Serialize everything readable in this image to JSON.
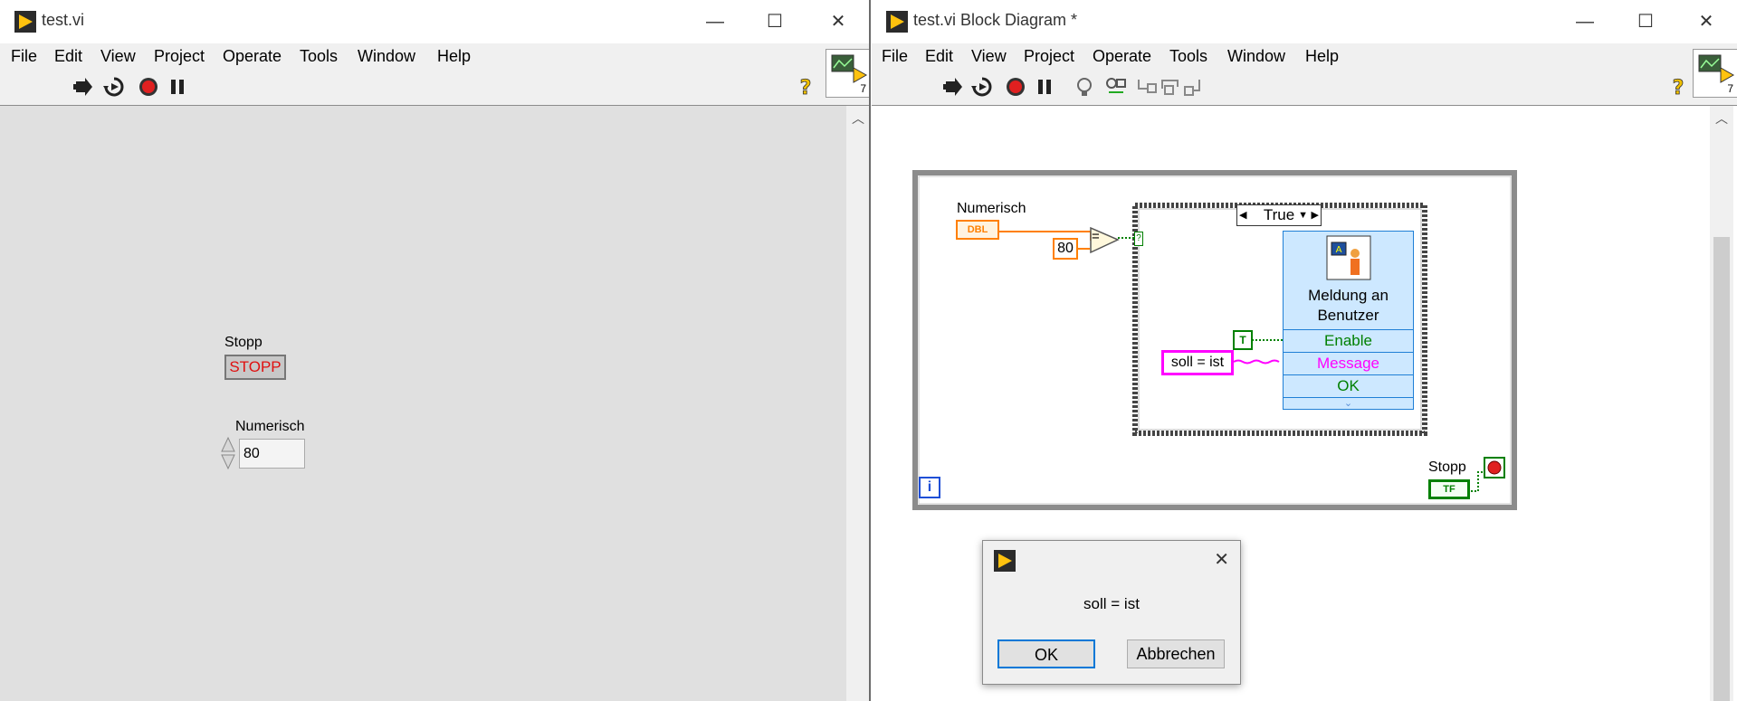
{
  "front_panel": {
    "title": "test.vi",
    "menu": [
      "File",
      "Edit",
      "View",
      "Project",
      "Operate",
      "Tools",
      "Window",
      "Help"
    ],
    "connector_number": "7",
    "controls": {
      "stop_label": "Stopp",
      "stop_button_text": "STOPP",
      "numeric_label": "Numerisch",
      "numeric_value": "80"
    }
  },
  "block_diagram": {
    "title": "test.vi Block Diagram *",
    "menu": [
      "File",
      "Edit",
      "View",
      "Project",
      "Operate",
      "Tools",
      "Window",
      "Help"
    ],
    "connector_number": "7",
    "numeric_label": "Numerisch",
    "numeric_type": "DBL",
    "constant_80": "80",
    "equal_symbol": "=",
    "case_selector": "True",
    "string_constant": "soll = ist",
    "bool_constant": "T",
    "message_node": {
      "title_line1": "Meldung an",
      "title_line2": "Benutzer",
      "terminals": [
        "Enable",
        "Message",
        "OK"
      ]
    },
    "stop_label": "Stopp",
    "stop_terminal_type": "TF",
    "iteration_label": "i"
  },
  "dialog": {
    "message": "soll = ist",
    "ok_label": "OK",
    "cancel_label": "Abbrechen"
  },
  "colors": {
    "labview_orange": "#ff8000",
    "string_pink": "#ff00ff",
    "boolean_green": "#008000",
    "node_blue": "#cde8ff",
    "accent_blue": "#0078d7"
  }
}
